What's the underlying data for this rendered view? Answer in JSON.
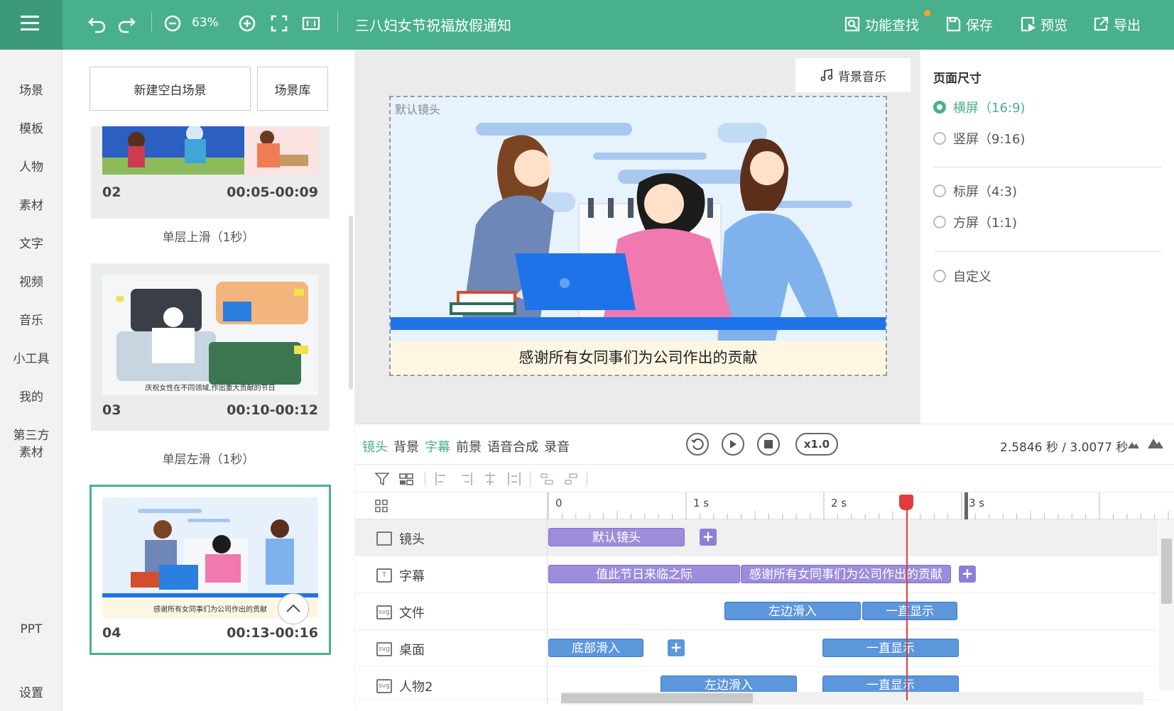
{
  "toolbar": {
    "zoom": "63%",
    "doc_title": "三八妇女节祝福放假通知",
    "find_label": "功能查找",
    "save_label": "保存",
    "preview_label": "预览",
    "export_label": "导出"
  },
  "nav": [
    "场景",
    "模板",
    "人物",
    "素材",
    "文字",
    "视频",
    "音乐",
    "小工具",
    "我的",
    "第三方素材",
    "PPT",
    "设置"
  ],
  "scenes": {
    "new_blank": "新建空白场景",
    "library": "场景库",
    "cards": [
      {
        "num": "02",
        "time": "00:05-00:09",
        "transition": "单层上滑（1秒）"
      },
      {
        "num": "03",
        "time": "00:10-00:12",
        "transition": "单层左滑（1秒）",
        "thumb_caption": "庆祝女性在不同领域,作出重大贡献的节日"
      },
      {
        "num": "04",
        "time": "00:13-00:16",
        "thumb_caption": "感谢所有女同事们为公司作出的贡献"
      }
    ]
  },
  "canvas": {
    "bgm_label": "背景音乐",
    "stage_label": "默认镜头",
    "subtitle": "感谢所有女同事们为公司作出的贡献"
  },
  "page_size": {
    "title": "页面尺寸",
    "options": [
      {
        "label": "横屏（16:9)",
        "selected": true
      },
      {
        "label": "竖屏（9:16)",
        "selected": false
      },
      {
        "label": "标屏（4:3)",
        "selected": false
      },
      {
        "label": "方屏（1:1)",
        "selected": false
      },
      {
        "label": "自定义",
        "selected": false
      }
    ]
  },
  "timeline": {
    "tabs": [
      "镜头",
      "背景",
      "字幕",
      "前景",
      "语音合成",
      "录音"
    ],
    "active_tabs": [
      "镜头",
      "字幕"
    ],
    "speed": "x1.0",
    "time_info": "2.5846 秒 / 3.0077 秒",
    "ruler_labels": [
      "0",
      "1 s",
      "2 s",
      "3 s"
    ],
    "playhead_seconds": 2.5846,
    "tracks": [
      {
        "label": "镜头",
        "clips": [
          "默认镜头"
        ]
      },
      {
        "label": "字幕",
        "clips": [
          "值此节日来临之际",
          "感谢所有女同事们为公司作出的贡献"
        ]
      },
      {
        "label": "文件",
        "clips": [
          "左边滑入",
          "一直显示"
        ]
      },
      {
        "label": "桌面",
        "clips": [
          "底部滑入",
          "一直显示"
        ]
      },
      {
        "label": "人物2",
        "clips": [
          "左边滑入",
          "一直显示"
        ]
      }
    ]
  },
  "colors": {
    "brand": "#49b08c",
    "clip_purple": "#9c8cdb",
    "clip_blue": "#5c96db",
    "playhead": "#e23c3c"
  }
}
